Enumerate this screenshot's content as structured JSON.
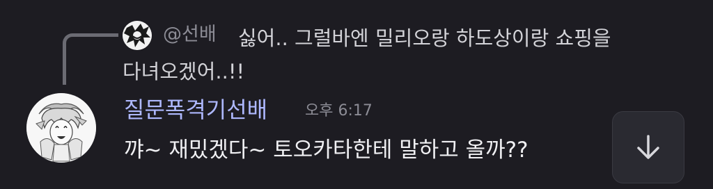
{
  "reply": {
    "username": "@선배",
    "text_line1": "싫어.. 그럴바엔 밀리오랑 하도상이랑 쇼핑을",
    "text_line2": "다녀오겠어..!!"
  },
  "message": {
    "author": "질문폭격기선배",
    "timestamp": "오후 6:17",
    "text": "꺄~ 재밌겠다~ 토오카타한테 말하고 올까??"
  },
  "icons": {
    "jump": "arrow-down-icon"
  },
  "colors": {
    "background": "#1d1c22",
    "author": "#aeb8ff",
    "muted": "#8c8c95",
    "button_bg": "#2a2a31"
  }
}
